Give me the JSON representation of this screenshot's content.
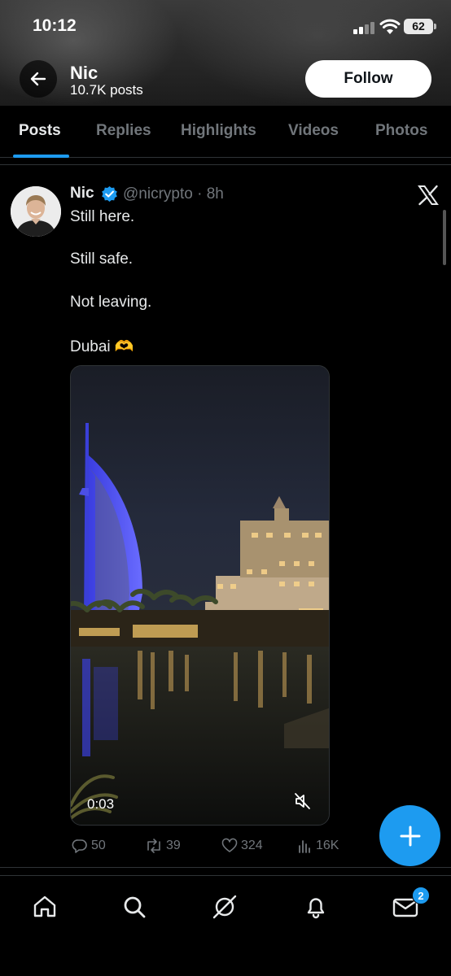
{
  "status_bar": {
    "time": "10:12",
    "battery": "62"
  },
  "profile": {
    "name": "Nic",
    "posts_count": "10.7K posts",
    "follow_label": "Follow"
  },
  "tabs": [
    {
      "label": "Posts",
      "active": true
    },
    {
      "label": "Replies",
      "active": false
    },
    {
      "label": "Highlights",
      "active": false
    },
    {
      "label": "Videos",
      "active": false
    },
    {
      "label": "Photos",
      "active": false
    }
  ],
  "post": {
    "author": "Nic",
    "handle_time": "@nicrypto · 8h",
    "lines": [
      "Still here.",
      "Still safe.",
      "Not leaving.",
      "Dubai 🫶"
    ],
    "video_duration": "0:03",
    "stats": {
      "replies": "50",
      "reposts": "39",
      "likes": "324",
      "views": "16K"
    }
  },
  "bottom_nav": {
    "messages_badge": "2"
  },
  "colors": {
    "accent": "#1d9bf0",
    "background": "#000000",
    "text_primary": "#e7e9ea",
    "text_secondary": "#71767b"
  },
  "icons": [
    "back-arrow-icon",
    "verified-icon",
    "x-logo-icon",
    "mute-icon",
    "reply-icon",
    "repost-icon",
    "like-icon",
    "views-icon",
    "compose-plus-icon",
    "home-icon",
    "search-icon",
    "grok-icon",
    "notifications-icon",
    "messages-icon"
  ]
}
